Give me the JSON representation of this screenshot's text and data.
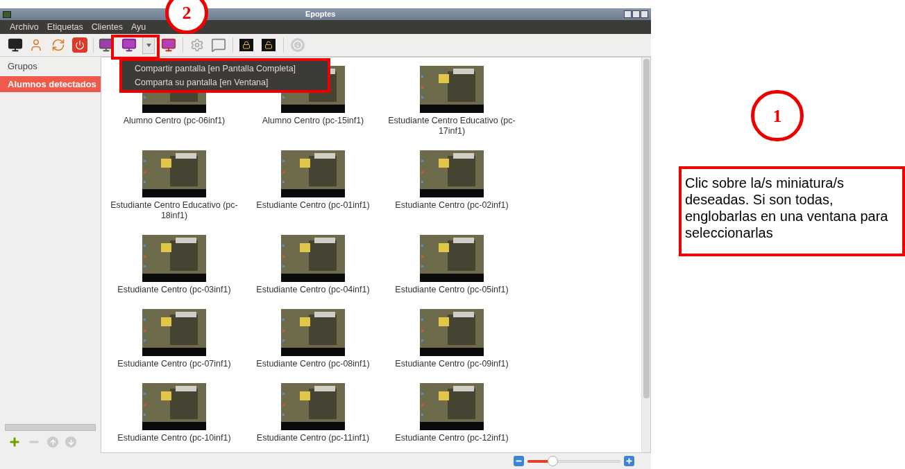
{
  "window": {
    "title": "Epoptes"
  },
  "menu_all": [
    "Archivo",
    "Etiquetas",
    "Clientes",
    "Ayu"
  ],
  "sidebar": {
    "title": "Grupos",
    "items": [
      {
        "label": "Alumnos detectados",
        "selected": true
      }
    ]
  },
  "dropdown_menu": [
    "Compartir pantalla [en Pantalla Completa]",
    "Comparta su pantalla [en Ventana]"
  ],
  "clients": [
    {
      "label": "Alumno Centro (pc-06inf1)"
    },
    {
      "label": "Alumno Centro (pc-15inf1)"
    },
    {
      "label": "Estudiante Centro Educativo (pc-17inf1)"
    },
    {
      "label": "Estudiante Centro Educativo (pc-18inf1)"
    },
    {
      "label": "Estudiante Centro (pc-01inf1)"
    },
    {
      "label": "Estudiante Centro (pc-02inf1)"
    },
    {
      "label": "Estudiante Centro (pc-03inf1)"
    },
    {
      "label": "Estudiante Centro (pc-04inf1)"
    },
    {
      "label": "Estudiante Centro (pc-05inf1)"
    },
    {
      "label": "Estudiante Centro (pc-07inf1)"
    },
    {
      "label": "Estudiante Centro (pc-08inf1)"
    },
    {
      "label": "Estudiante Centro (pc-09inf1)"
    },
    {
      "label": "Estudiante Centro (pc-10inf1)"
    },
    {
      "label": "Estudiante Centro (pc-11inf1)"
    },
    {
      "label": "Estudiante Centro (pc-12inf1)"
    }
  ],
  "zoom_slider": {
    "level": 0.27
  },
  "annotations": {
    "step_2": "2",
    "step_1": "1",
    "note": "Clic sobre la/s miniatura/s deseadas. Si son todas, englobarlas en una ventana para seleccionarlas"
  }
}
